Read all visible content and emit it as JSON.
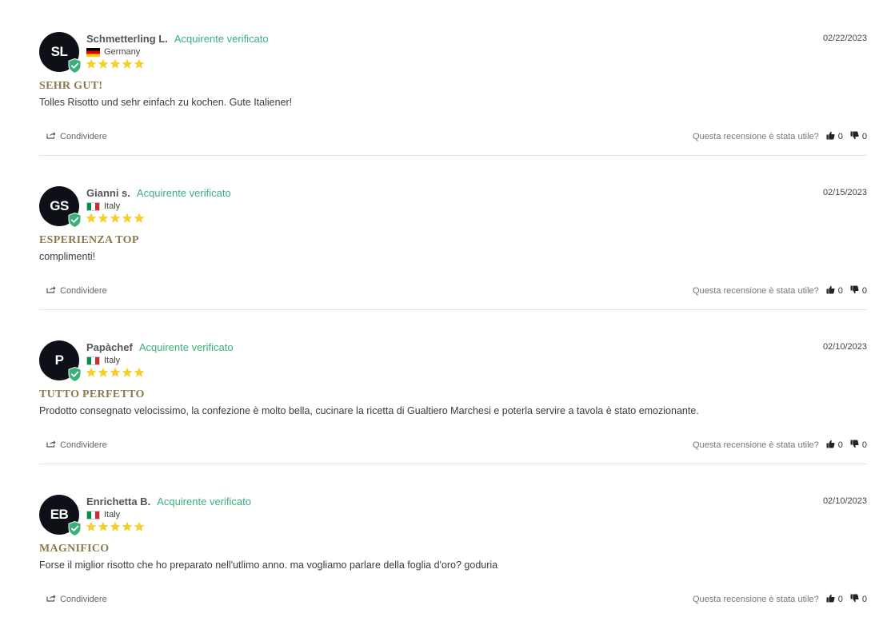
{
  "verified_label": "Acquirente verificato",
  "share_label": "Condividere",
  "helpful_question": "Questa recensione è stata utile?",
  "colors": {
    "verified": "#3ab07a",
    "star": "#f6cf2e",
    "title": "#8b7a4f",
    "avatar_bg": "#0d1117"
  },
  "reviews": [
    {
      "initials": "SL",
      "name": "Schmetterling L.",
      "country": "Germany",
      "flag": "flag-de",
      "rating": 5,
      "date": "02/22/2023",
      "title": "SEHR GUT!",
      "body": "Tolles Risotto und sehr einfach zu kochen. Gute Italiener!",
      "upvotes": "0",
      "downvotes": "0"
    },
    {
      "initials": "GS",
      "name": "Gianni s.",
      "country": "Italy",
      "flag": "flag-it",
      "rating": 5,
      "date": "02/15/2023",
      "title": "ESPERIENZA TOP",
      "body": "complimenti!",
      "upvotes": "0",
      "downvotes": "0"
    },
    {
      "initials": "P",
      "name": "Papàchef",
      "country": "Italy",
      "flag": "flag-it",
      "rating": 5,
      "date": "02/10/2023",
      "title": "TUTTO PERFETTO",
      "body": "Prodotto consegnato velocissimo, la confezione è molto bella, cucinare la ricetta di Gualtiero Marchesi e poterla servire a tavola è stato emozionante.",
      "upvotes": "0",
      "downvotes": "0"
    },
    {
      "initials": "EB",
      "name": "Enrichetta B.",
      "country": "Italy",
      "flag": "flag-it",
      "rating": 5,
      "date": "02/10/2023",
      "title": "MAGNIFICO",
      "body": "Forse il miglior risotto che ho preparato nell'utlimo anno. ma vogliamo parlare della foglia d'oro? goduria",
      "upvotes": "0",
      "downvotes": "0"
    }
  ]
}
